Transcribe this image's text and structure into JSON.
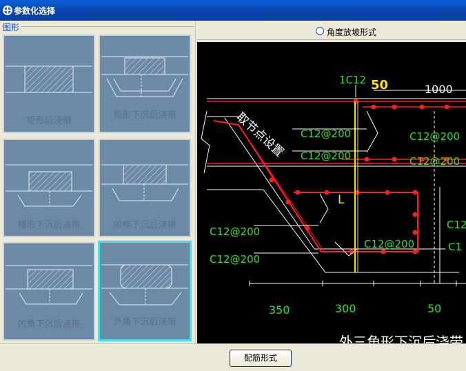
{
  "window": {
    "title": "参数化选择"
  },
  "group": {
    "label": "图形"
  },
  "cards": [
    {
      "label": "矩形后浇带"
    },
    {
      "label": "矩形下沉后浇带"
    },
    {
      "label": "槽形下沉后浇带"
    },
    {
      "label": "阶梯下沉后浇带"
    },
    {
      "label": "内角下沉后浇带"
    },
    {
      "label": "外角下沉后浇带",
      "selected": true
    }
  ],
  "options": {
    "angle_slope_label": "角度放坡形式",
    "angle_slope_checked": false
  },
  "drawing": {
    "rebar_top": "1C12",
    "dim_50_top": "50",
    "dim_1000": "1000",
    "node_text": "取节点设置",
    "c12_200": "C12@200",
    "c12_partial": "C12",
    "c1_partial": "C1",
    "span_L": "L",
    "dim_350": "350",
    "dim_300": "300",
    "dim_50_bottom": "50",
    "caption": "外三角形下沉后浇带"
  },
  "colors": {
    "accent_selected": "#3fe0f0",
    "card_bg": "#6d8aa5",
    "rebar": "#ff2020",
    "dim_text": "#33e033",
    "title_bar": "#0847b0"
  },
  "footer": {
    "button_label": "配筋形式"
  }
}
